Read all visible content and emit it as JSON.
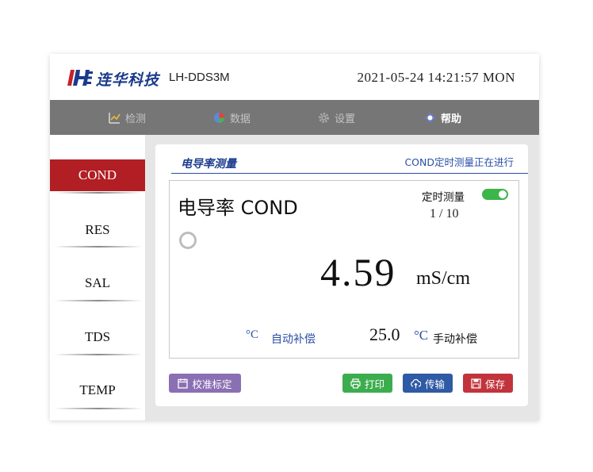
{
  "header": {
    "brand": "连华科技",
    "model": "LH-DDS3M",
    "datetime": "2021-05-24 14:21:57 MON"
  },
  "topnav": [
    {
      "label": "检测",
      "icon": "chart-icon",
      "active": false
    },
    {
      "label": "数据",
      "icon": "pie-chart-icon",
      "active": false
    },
    {
      "label": "设置",
      "icon": "gear-icon",
      "active": false
    },
    {
      "label": "帮助",
      "icon": "help-icon",
      "active": true
    }
  ],
  "sidebar": {
    "items": [
      {
        "label": "COND",
        "active": true
      },
      {
        "label": "RES",
        "active": false
      },
      {
        "label": "SAL",
        "active": false
      },
      {
        "label": "TDS",
        "active": false
      },
      {
        "label": "TEMP",
        "active": false
      }
    ]
  },
  "card": {
    "title": "电导率测量",
    "status": "COND定时测量正在进行"
  },
  "measurement": {
    "title": "电导率 COND",
    "timer_label": "定时测量",
    "timer_on": true,
    "progress": "1 / 10",
    "value": "4.59",
    "unit": "mS/cm",
    "comp_unit": "°C",
    "comp_auto": "自动补偿",
    "temp_value": "25.0",
    "temp_unit": "°C",
    "manual": "手动补偿"
  },
  "buttons": {
    "calibrate": "校准标定",
    "print": "打印",
    "send": "传输",
    "save": "保存"
  },
  "colors": {
    "brand_blue": "#1a3a8c",
    "active_red": "#b11e24",
    "toggle_green": "#3cb54a",
    "nav_gray": "#767676"
  }
}
